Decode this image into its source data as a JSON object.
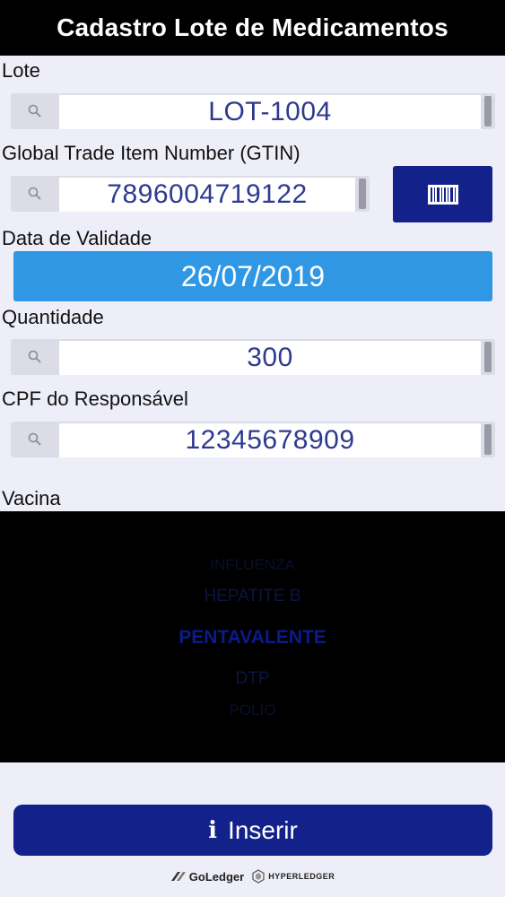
{
  "header": {
    "title": "Cadastro Lote de Medicamentos"
  },
  "fields": {
    "lote": {
      "label": "Lote",
      "value": "LOT-1004"
    },
    "gtin": {
      "label": "Global Trade Item Number (GTIN)",
      "value": "7896004719122"
    },
    "validade": {
      "label": "Data de Validade",
      "value": "26/07/2019"
    },
    "quantidade": {
      "label": "Quantidade",
      "value": "300"
    },
    "cpf": {
      "label": "CPF do Responsável",
      "value": "12345678909"
    }
  },
  "vacina": {
    "label": "Vacina",
    "options": [
      "INFLUENZA",
      "HEPATITE B",
      "PENTAVALENTE",
      "DTP",
      "POLIO"
    ],
    "selected": "PENTAVALENTE"
  },
  "actions": {
    "insert_label": "Inserir"
  },
  "footer": {
    "brand1": "GoLedger",
    "brand2": "HYPERLEDGER"
  },
  "colors": {
    "header_bg": "#000000",
    "primary": "#13228a",
    "date_button": "#2f97e4",
    "input_text": "#2e3a8f",
    "background": "#eeeef8"
  },
  "icons": [
    "search-icon",
    "barcode-icon",
    "info-icon"
  ]
}
